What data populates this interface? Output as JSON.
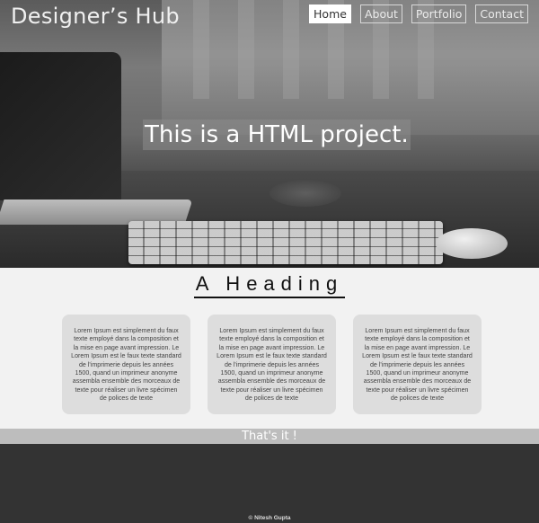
{
  "brand": "Designer’s Hub",
  "nav": {
    "home": "Home",
    "about": "About",
    "portfolio": "Portfolio",
    "contact": "Contact"
  },
  "hero": {
    "title": "This is a HTML project."
  },
  "section": {
    "heading": "A Heading",
    "cards": [
      {
        "text": "Lorem Ipsum est simplement du faux texte employé dans la composition et la mise en page avant impression. Le Lorem Ipsum est le faux texte standard de l'imprimerie depuis les années 1500, quand un imprimeur anonyme assembla ensemble des morceaux de texte pour réaliser un livre spécimen de polices de texte"
      },
      {
        "text": "Lorem Ipsum est simplement du faux texte employé dans la composition et la mise en page avant impression. Le Lorem Ipsum est le faux texte standard de l'imprimerie depuis les années 1500, quand un imprimeur anonyme assembla ensemble des morceaux de texte pour réaliser un livre spécimen de polices de texte"
      },
      {
        "text": "Lorem Ipsum est simplement du faux texte employé dans la composition et la mise en page avant impression. Le Lorem Ipsum est le faux texte standard de l'imprimerie depuis les années 1500, quand un imprimeur anonyme assembla ensemble des morceaux de texte pour réaliser un livre spécimen de polices de texte"
      }
    ]
  },
  "banner": "That's it !",
  "footer": {
    "copyright": "© Nitesh Gupta"
  },
  "colors": {
    "footer_bg": "#333333",
    "banner_bg": "#bdbdbd",
    "card_bg": "#dddddd"
  }
}
